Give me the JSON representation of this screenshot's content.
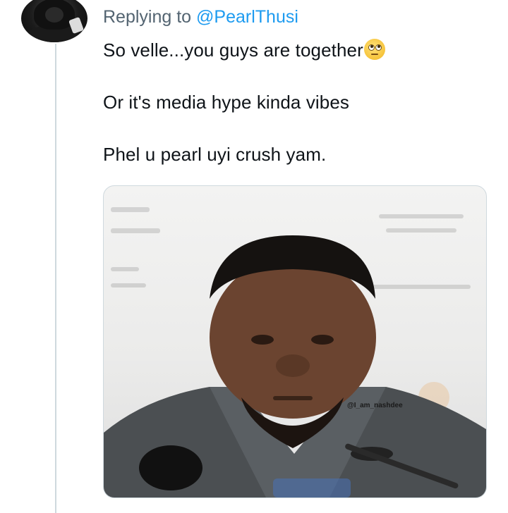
{
  "reply": {
    "prefix": "Replying to",
    "handle": "@PearlThusi"
  },
  "tweet": {
    "line1": "So velle...you guys are together",
    "line1_emoji": "face-with-rolling-eyes-icon",
    "line2": "Or it's media hype kinda vibes",
    "line3": "Phel u pearl uyi crush yam."
  },
  "media": {
    "watermark": "@I_am_nashdee"
  },
  "colors": {
    "text": "#0f1419",
    "muted": "#536471",
    "link": "#1d9bf0",
    "border": "#cfd9de"
  }
}
